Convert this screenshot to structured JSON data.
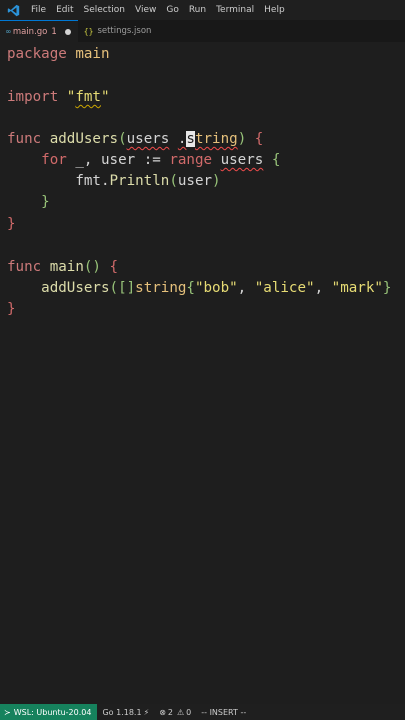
{
  "menubar": {
    "items": [
      "File",
      "Edit",
      "Selection",
      "View",
      "Go",
      "Run",
      "Terminal",
      "Help"
    ]
  },
  "tabs": [
    {
      "icon_text": "∞",
      "label": "main.go",
      "problems": "1",
      "modified": true,
      "active": true
    },
    {
      "icon_text": "{}",
      "label": "settings.json",
      "active": false
    }
  ],
  "code": {
    "l1_kw": "package",
    "l1_name": "main",
    "l3_kw": "import",
    "l3_q1": "\"",
    "l3_str": "fmt",
    "l3_q2": "\"",
    "l5_kw": "func",
    "l5_fn": "addUsers",
    "l5_open": "(",
    "l5_param": "users",
    "l5_sp": " ",
    "l5_dot": ".",
    "l5_cursor": "s",
    "l5_type": "tring",
    "l5_close": ")",
    "l5_brace": " {",
    "l6_indent": "    ",
    "l6_for": "for",
    "l6_blank": " _",
    "l6_comma": ", ",
    "l6_user": "user",
    "l6_assign": " := ",
    "l6_range": "range",
    "l6_sp": " ",
    "l6_users": "users",
    "l6_brace": " {",
    "l7_indent": "        ",
    "l7_pkg": "fmt",
    "l7_dot": ".",
    "l7_fn": "Println",
    "l7_open": "(",
    "l7_arg": "user",
    "l7_close": ")",
    "l8_indent": "    ",
    "l8_brace": "}",
    "l9_brace": "}",
    "l11_kw": "func",
    "l11_fn": "main",
    "l11_parens": "()",
    "l11_brace": " {",
    "l12_indent": "    ",
    "l12_fn": "addUsers",
    "l12_open": "(",
    "l12_slice": "[]",
    "l12_type": "string",
    "l12_lb": "{",
    "l12_s1": "\"bob\"",
    "l12_c1": ", ",
    "l12_s2": "\"alice\"",
    "l12_c2": ", ",
    "l12_s3": "\"mark\"",
    "l12_rb": "}",
    "l13_brace": "}"
  },
  "statusbar": {
    "remote": "WSL: Ubuntu-20.04",
    "go_version": "Go 1.18.1",
    "errors": "2",
    "warnings": "0",
    "mode": "-- INSERT --"
  },
  "colors": {
    "remote_bg": "#16825d",
    "accent": "#0078d4",
    "keyword": "#cc7a7a",
    "string": "#e6db74",
    "function": "#dcdcaa"
  }
}
